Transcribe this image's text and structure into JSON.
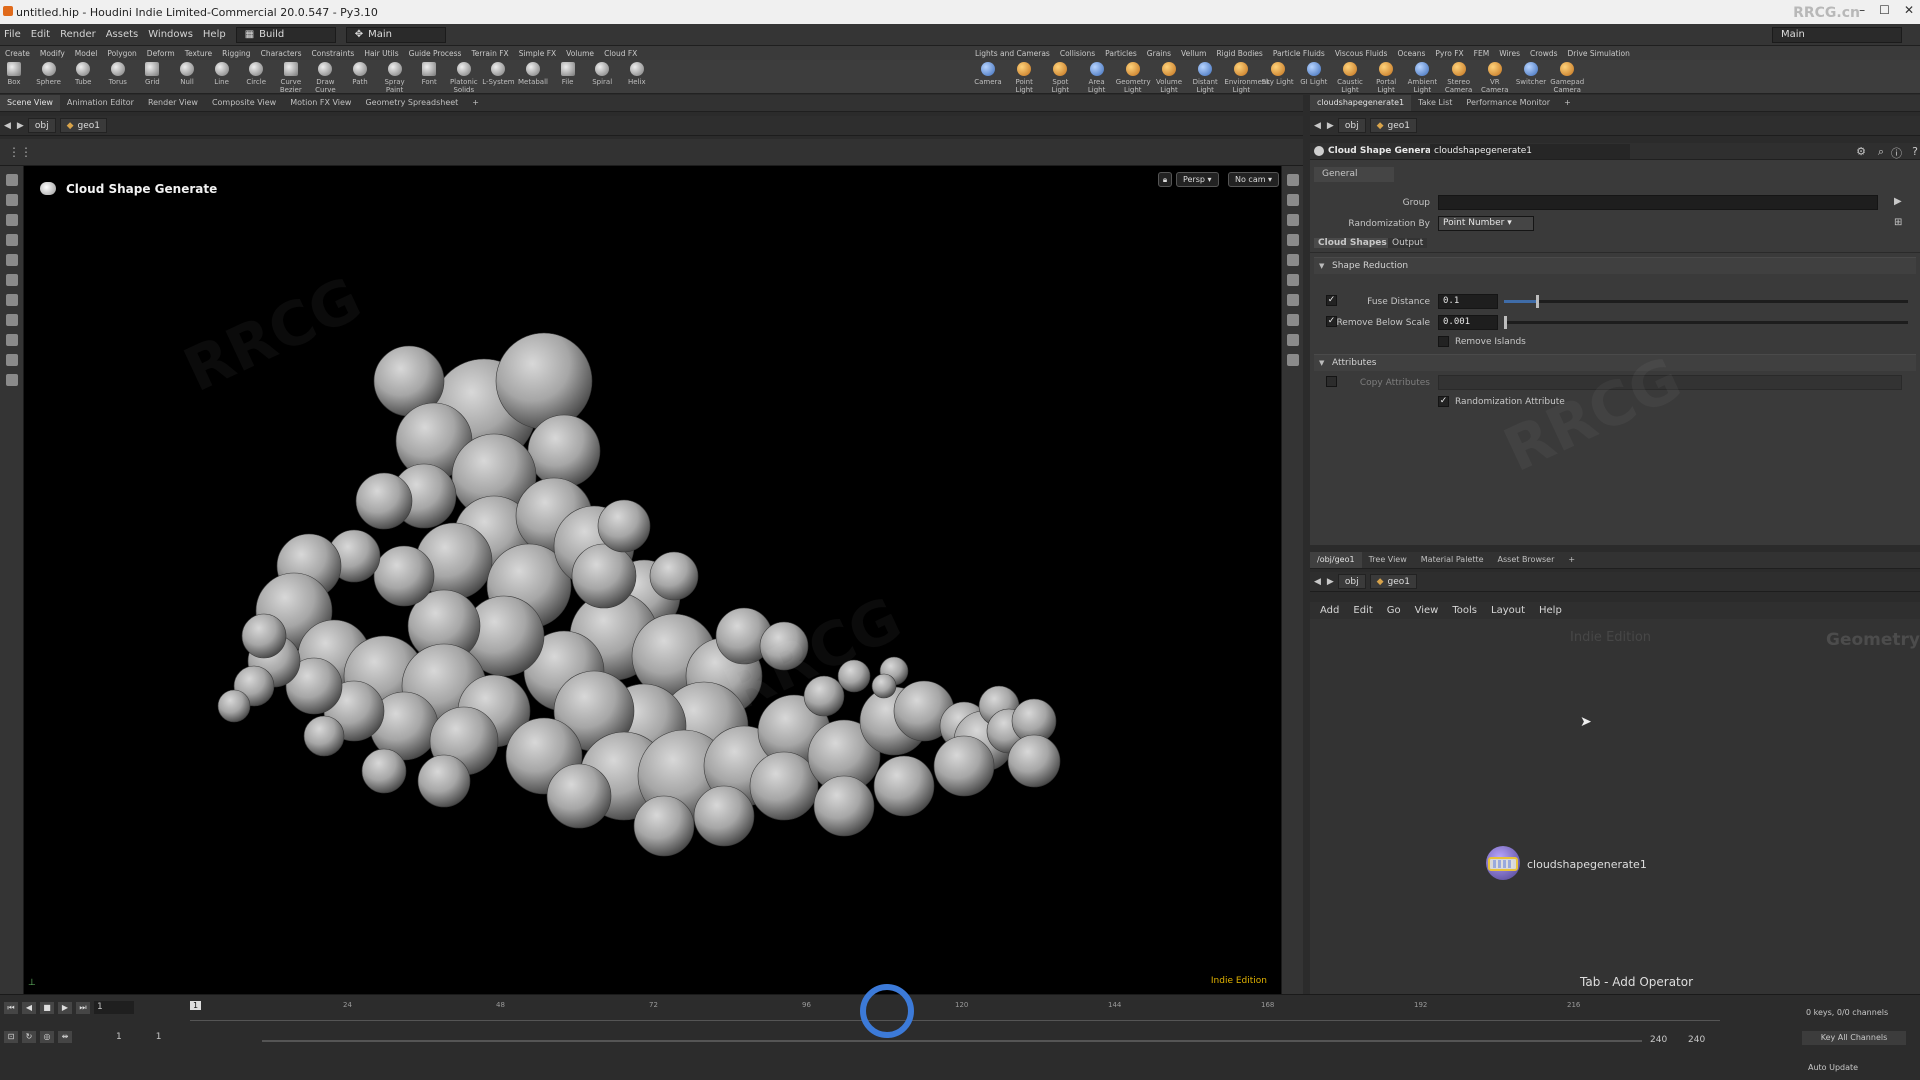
{
  "window": {
    "title": "untitled.hip - Houdini Indie Limited-Commercial 20.0.547 - Py3.10",
    "watermark": "RRCG.cn"
  },
  "menubar": {
    "items": [
      "File",
      "Edit",
      "Render",
      "Assets",
      "Windows",
      "Help"
    ],
    "desktop": "Build",
    "context": "Main",
    "right_desktop": "Main"
  },
  "shelf_tabs_left": [
    "Create",
    "Modify",
    "Model",
    "Polygon",
    "Deform",
    "Texture",
    "Rigging",
    "Characters",
    "Constraints",
    "Hair Utils",
    "Guide Process",
    "Terrain FX",
    "Simple FX",
    "Volume",
    "Cloud FX"
  ],
  "shelf_tabs_right": [
    "Lights and Cameras",
    "Collisions",
    "Particles",
    "Grains",
    "Vellum",
    "Rigid Bodies",
    "Particle Fluids",
    "Viscous Fluids",
    "Oceans",
    "Pyro FX",
    "FEM",
    "Wires",
    "Crowds",
    "Drive Simulation"
  ],
  "shelf_tools_left": [
    "Box",
    "Sphere",
    "Tube",
    "Torus",
    "Grid",
    "Null",
    "Line",
    "Circle",
    "Curve Bezier",
    "Draw Curve",
    "Path",
    "Spray Paint",
    "Font",
    "Platonic Solids",
    "L-System",
    "Metaball",
    "File",
    "Spiral",
    "Helix"
  ],
  "shelf_tools_right": [
    "Camera",
    "Point Light",
    "Spot Light",
    "Area Light",
    "Geometry Light",
    "Volume Light",
    "Distant Light",
    "Environment Light",
    "Sky Light",
    "GI Light",
    "Caustic Light",
    "Portal Light",
    "Ambient Light",
    "Stereo Camera",
    "VR Camera",
    "Switcher",
    "Gamepad Camera"
  ],
  "left_pane_tabs": [
    "Scene View",
    "Animation Editor",
    "Render View",
    "Composite View",
    "Motion FX View",
    "Geometry Spreadsheet"
  ],
  "right_top_tabs": [
    "cloudshapegenerate1",
    "Take List",
    "Performance Monitor"
  ],
  "path": {
    "root": "obj",
    "node": "geo1"
  },
  "viewport": {
    "title": "Cloud Shape Generate",
    "camera_mode": "Persp",
    "camera": "No cam",
    "edition": "Indie Edition"
  },
  "params": {
    "node_type": "Cloud Shape Generate",
    "node_name": "cloudshapegenerate1",
    "folder": "General",
    "group_label": "Group",
    "group_value": "",
    "randomization_by_label": "Randomization By",
    "randomization_by_value": "Point Number",
    "tabs": [
      "Cloud Shapes",
      "Output"
    ],
    "section_shape_reduction": "Shape Reduction",
    "fuse_distance_label": "Fuse Distance",
    "fuse_distance_value": "0.1",
    "fuse_distance_fraction": 0.1,
    "fuse_distance_enabled": true,
    "remove_below_scale_label": "Remove Below Scale",
    "remove_below_scale_value": "0.001",
    "remove_below_scale_fraction": 0.001,
    "remove_below_scale_enabled": true,
    "remove_islands_label": "Remove Islands",
    "remove_islands_checked": false,
    "section_attributes": "Attributes",
    "copy_attributes_label": "Copy Attributes",
    "copy_attributes_enabled": false,
    "randomization_attribute_label": "Randomization Attribute",
    "randomization_attribute_checked": true
  },
  "network": {
    "tabs": [
      "/obj/geo1",
      "Tree View",
      "Material Palette",
      "Asset Browser"
    ],
    "menu": [
      "Add",
      "Edit",
      "Go",
      "View",
      "Tools",
      "Layout",
      "Help"
    ],
    "edition_watermark": "Indie Edition",
    "context_label": "Geometry",
    "node_name": "cloudshapegenerate1",
    "hint": "Tab - Add Operator"
  },
  "timeline": {
    "current_frame": "1",
    "frame_marker": "1",
    "ticks": [
      "24",
      "48",
      "72",
      "96",
      "120",
      "144",
      "168",
      "192",
      "216"
    ],
    "range_start_a": "1",
    "range_start_b": "1",
    "range_end_a": "240",
    "range_end_b": "240",
    "keys_info": "0 keys, 0/0 channels",
    "key_all_channels": "Key All Channels",
    "auto_update": "Auto Update"
  },
  "colors": {
    "accent": "#3f6ca8",
    "indie": "#e0b100",
    "background": "#2b2b2b"
  }
}
